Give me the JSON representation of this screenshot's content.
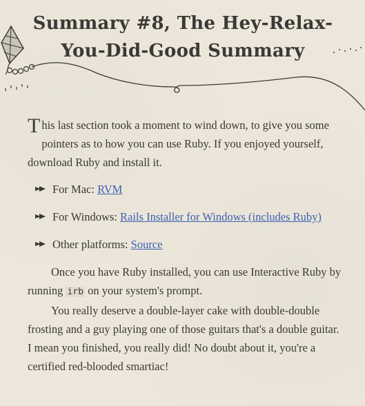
{
  "title_line1": "Summary #8, The Hey-Relax-",
  "title_line2": "You-Did-Good Summary",
  "intro": {
    "dropcap": "T",
    "text": "his last section took a moment to wind down, to give you some pointers as to how you can use Ruby. If you enjoyed yourself, download Ruby and install it."
  },
  "platforms": [
    {
      "label": "For Mac: ",
      "link": "RVM"
    },
    {
      "label": "For Windows: ",
      "link": "Rails Installer for Windows (includes Ruby)"
    },
    {
      "label": "Other platforms: ",
      "link": "Source"
    }
  ],
  "para2": {
    "before": "Once you have Ruby installed, you can use Interactive Ruby by running ",
    "code": "irb",
    "after": " on your system's prompt."
  },
  "para3": "You really deserve a double-layer cake with double-double frosting and a guy playing one of those guitars that's a double guitar. I mean you finished, you really did! No doubt about it, you're a certified red-blooded smartiac!",
  "colors": {
    "background": "#ece7da",
    "text": "#3a3836",
    "link": "#3c5fb6"
  },
  "icons": [
    "kite-icon",
    "kite-string-icon",
    "bullet-arrow-icon"
  ]
}
